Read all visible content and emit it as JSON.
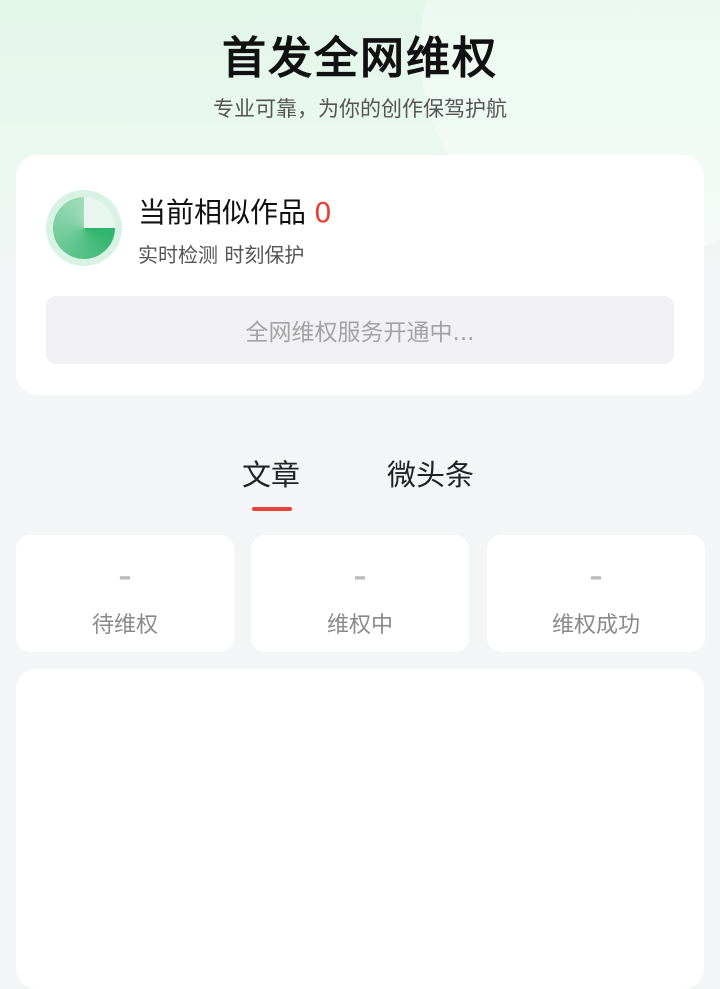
{
  "header": {
    "title": "首发全网维权",
    "subtitle": "专业可靠，为你的创作保驾护航"
  },
  "monitor": {
    "title": "当前相似作品",
    "count": "0",
    "subtitle": "实时检测 时刻保护",
    "status": "全网维权服务开通中..."
  },
  "tabs": [
    {
      "label": "文章",
      "active": true
    },
    {
      "label": "微头条",
      "active": false
    }
  ],
  "stats": [
    {
      "value": "–",
      "label": "待维权"
    },
    {
      "value": "–",
      "label": "维权中"
    },
    {
      "value": "–",
      "label": "维权成功"
    }
  ],
  "colors": {
    "accent": "#e6423a",
    "radar_green": "#2db36a"
  }
}
